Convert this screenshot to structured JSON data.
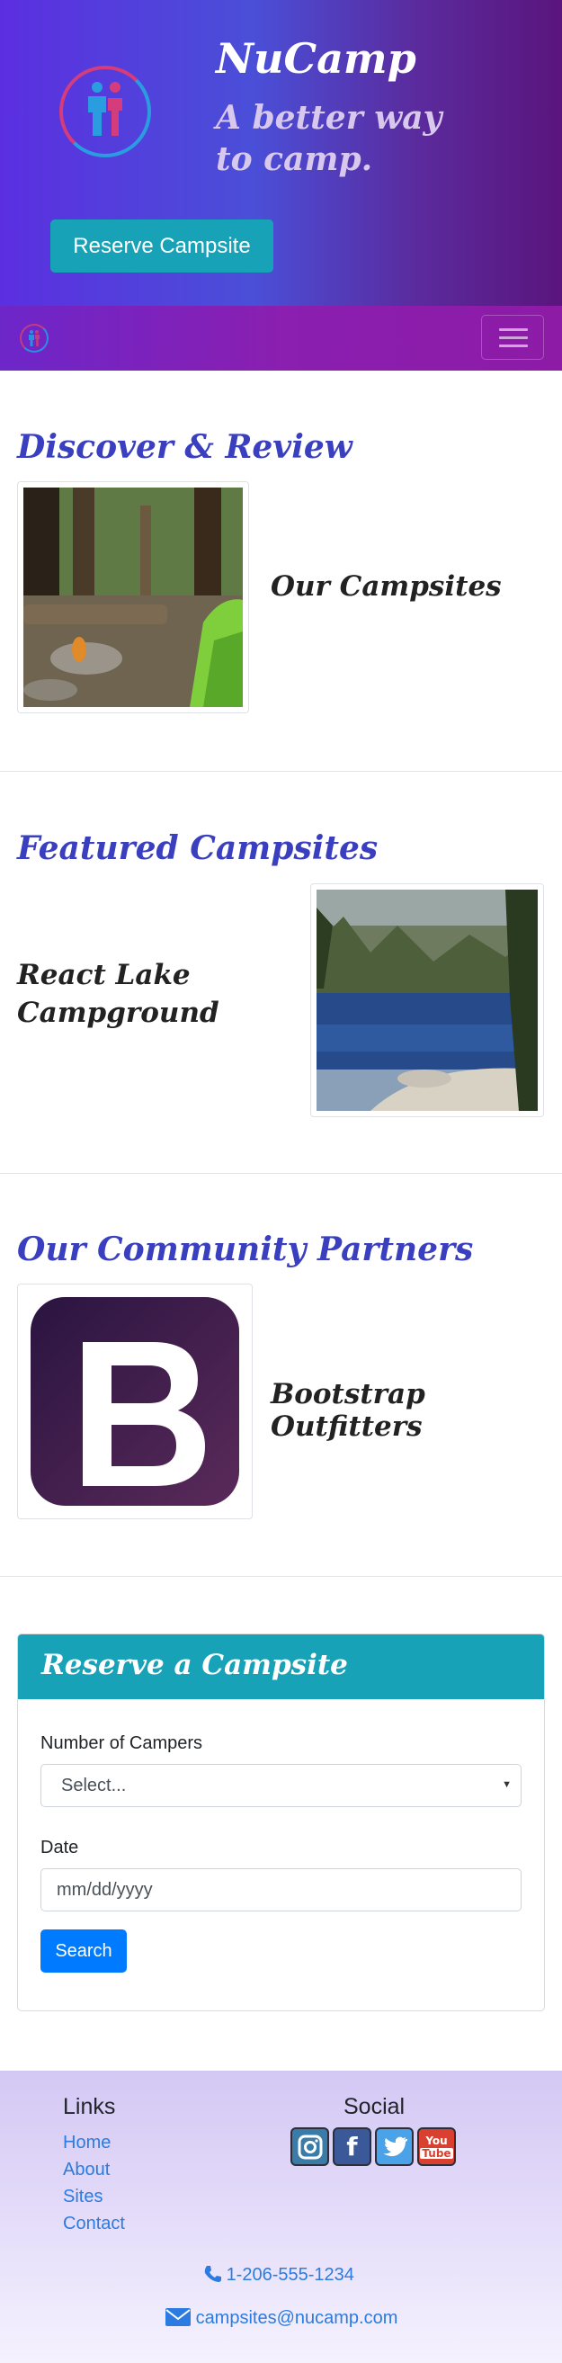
{
  "header": {
    "brand": "NuCamp",
    "tagline": "A better way to camp.",
    "reserve_button": "Reserve Campsite"
  },
  "navbar": {
    "menu_icon": "hamburger-icon"
  },
  "discover": {
    "heading": "Discover & Review",
    "item_title": "Our Campsites"
  },
  "featured": {
    "heading": "Featured Campsites",
    "item_title": "React Lake Campground"
  },
  "partners": {
    "heading": "Our Community Partners",
    "item_title": "Bootstrap Outfitters",
    "logo_letter": "B"
  },
  "reserve": {
    "title": "Reserve a Campsite",
    "campers_label": "Number of Campers",
    "campers_selected": "Select...",
    "date_label": "Date",
    "date_placeholder": "mm/dd/yyyy",
    "search_button": "Search"
  },
  "footer": {
    "links_heading": "Links",
    "links": [
      "Home",
      "About",
      "Sites",
      "Contact"
    ],
    "social_heading": "Social",
    "social_icons": [
      "instagram-icon",
      "facebook-icon",
      "twitter-icon",
      "youtube-icon"
    ],
    "phone": "1-206-555-1234",
    "email": "campsites@nucamp.com"
  },
  "colors": {
    "accent": "#17a2b8",
    "primary": "#007bff",
    "heading": "#3a3fbf",
    "link": "#2b7be0"
  }
}
